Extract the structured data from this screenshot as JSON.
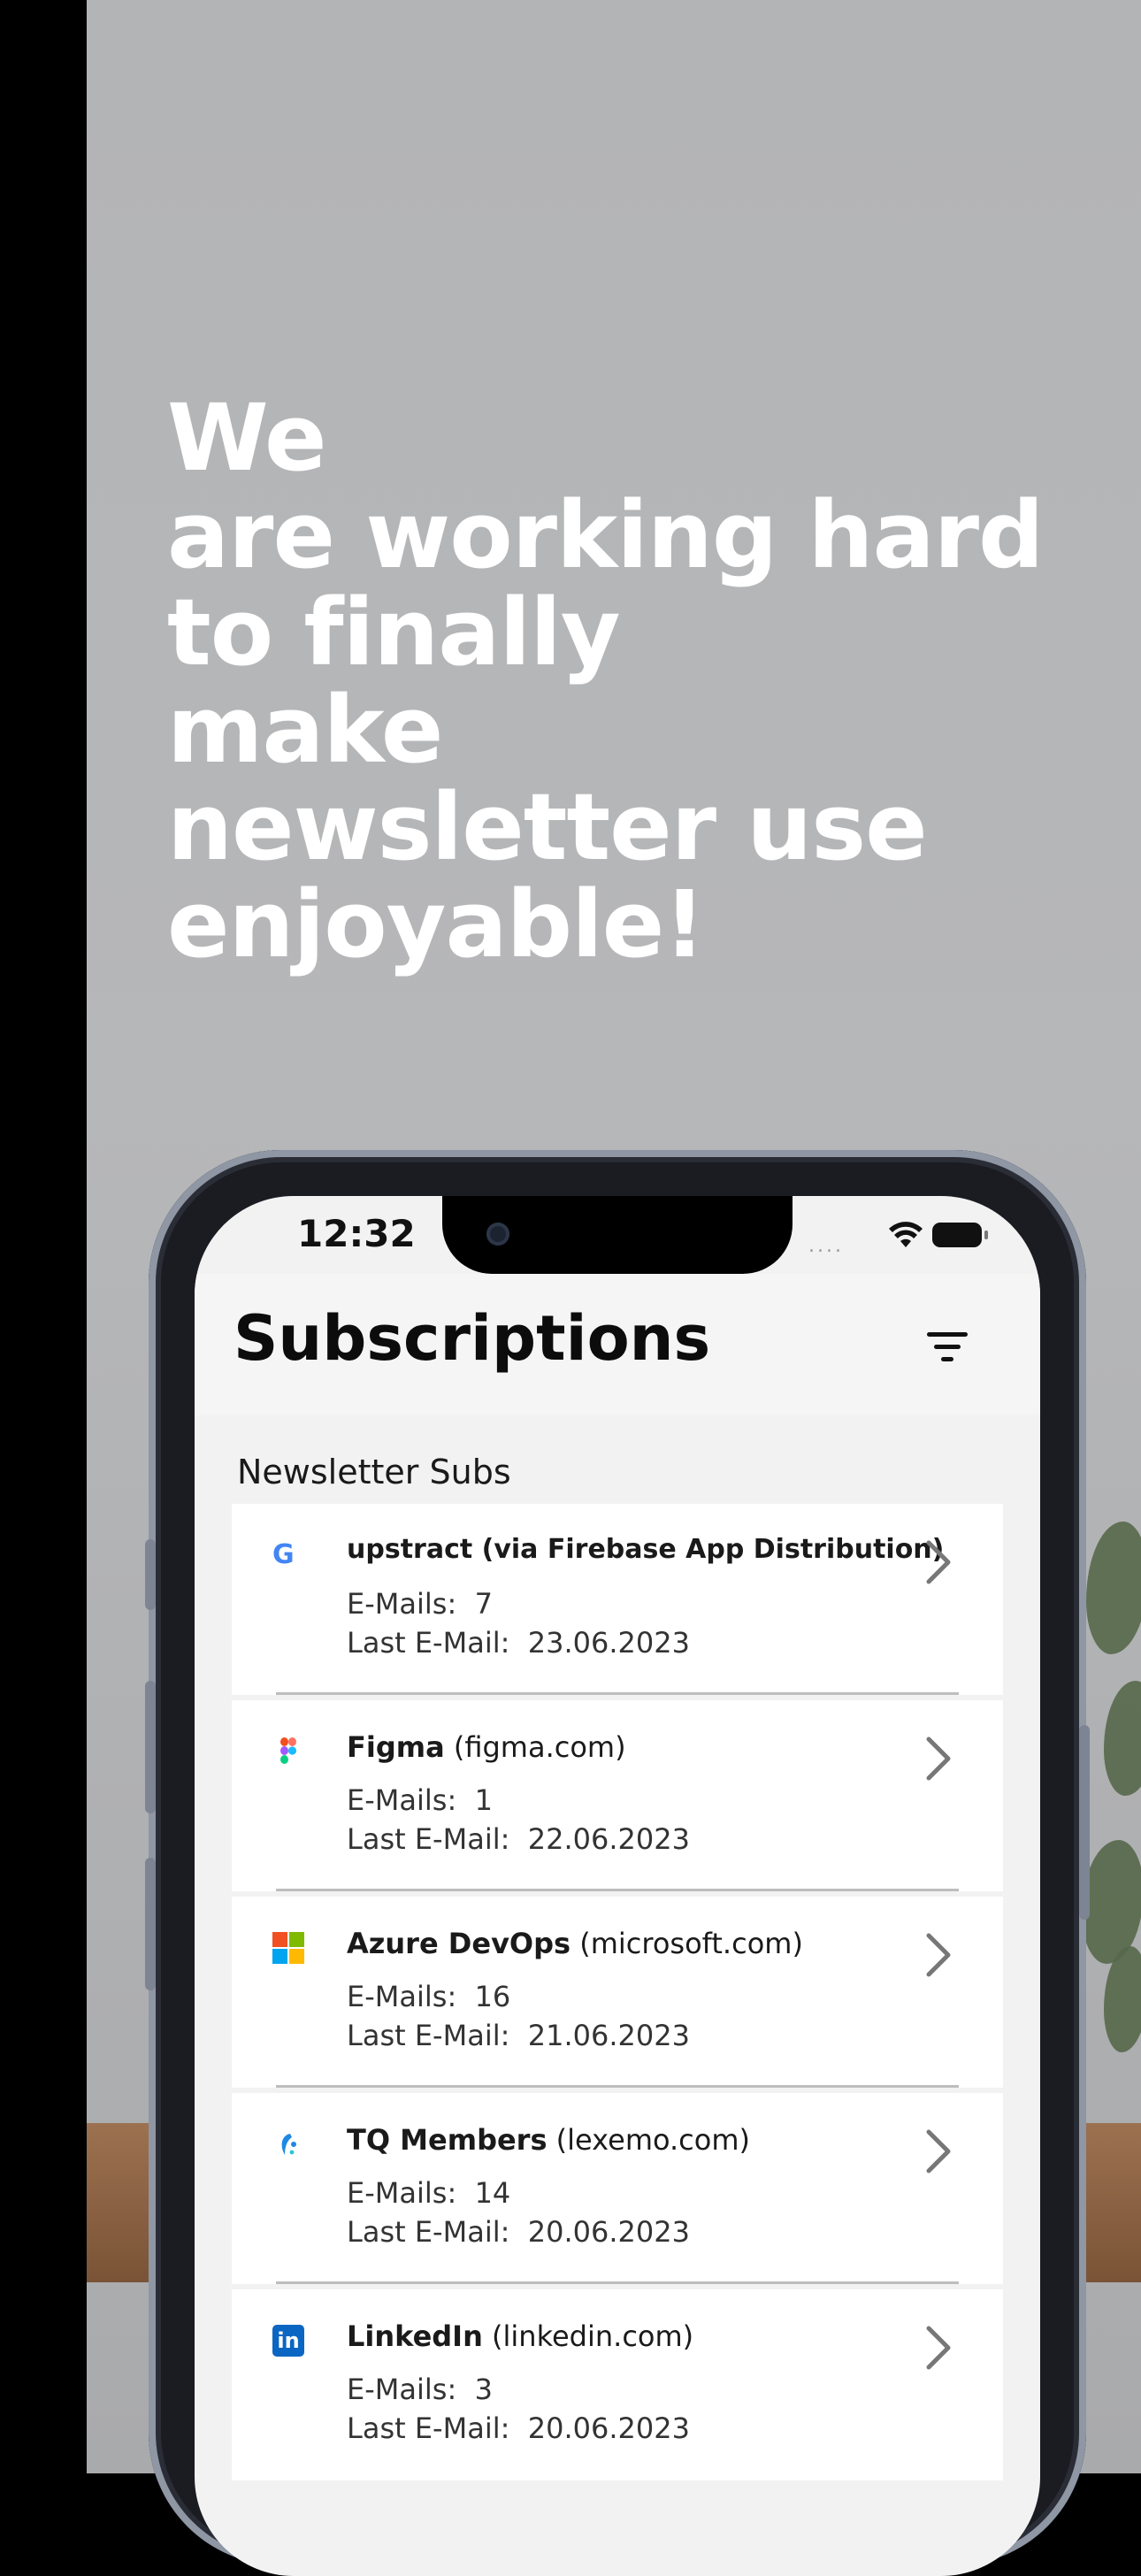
{
  "promo": {
    "headline": "We\nare working hard\nto finally\nmake\nnewsletter use\nenjoyable!"
  },
  "status_bar": {
    "time": "12:32",
    "signal_dots": "....",
    "wifi_icon": "wifi-icon",
    "battery_icon": "battery-icon"
  },
  "header": {
    "title": "Subscriptions",
    "filter_icon": "filter-icon"
  },
  "section_title": "Newsletter Subs",
  "colors": {
    "background": "#b4b5b7",
    "list_bg": "#ffffff",
    "screen_bg": "#f2f2f3",
    "text": "#1a1a1a",
    "linkedin": "#0a66c2"
  },
  "subscriptions": [
    {
      "logo": "google-logo-icon",
      "name": "upstract (via Firebase App Distribution)",
      "domain": "",
      "emails_label": "E-Mails:",
      "emails": "7",
      "last_label": "Last E-Mail:",
      "last": "23.06.2023"
    },
    {
      "logo": "figma-logo-icon",
      "name": "Figma",
      "domain": "(figma.com)",
      "emails_label": "E-Mails:",
      "emails": "1",
      "last_label": "Last E-Mail:",
      "last": "22.06.2023"
    },
    {
      "logo": "microsoft-logo-icon",
      "name": "Azure DevOps",
      "domain": "(microsoft.com)",
      "emails_label": "E-Mails:",
      "emails": "16",
      "last_label": "Last E-Mail:",
      "last": "21.06.2023"
    },
    {
      "logo": "lexemo-logo-icon",
      "name": "TQ Members",
      "domain": "(lexemo.com)",
      "emails_label": "E-Mails:",
      "emails": "14",
      "last_label": "Last E-Mail:",
      "last": "20.06.2023"
    },
    {
      "logo": "linkedin-logo-icon",
      "name": "LinkedIn",
      "domain": "(linkedin.com)",
      "emails_label": "E-Mails:",
      "emails": "3",
      "last_label": "Last E-Mail:",
      "last": "20.06.2023"
    }
  ]
}
